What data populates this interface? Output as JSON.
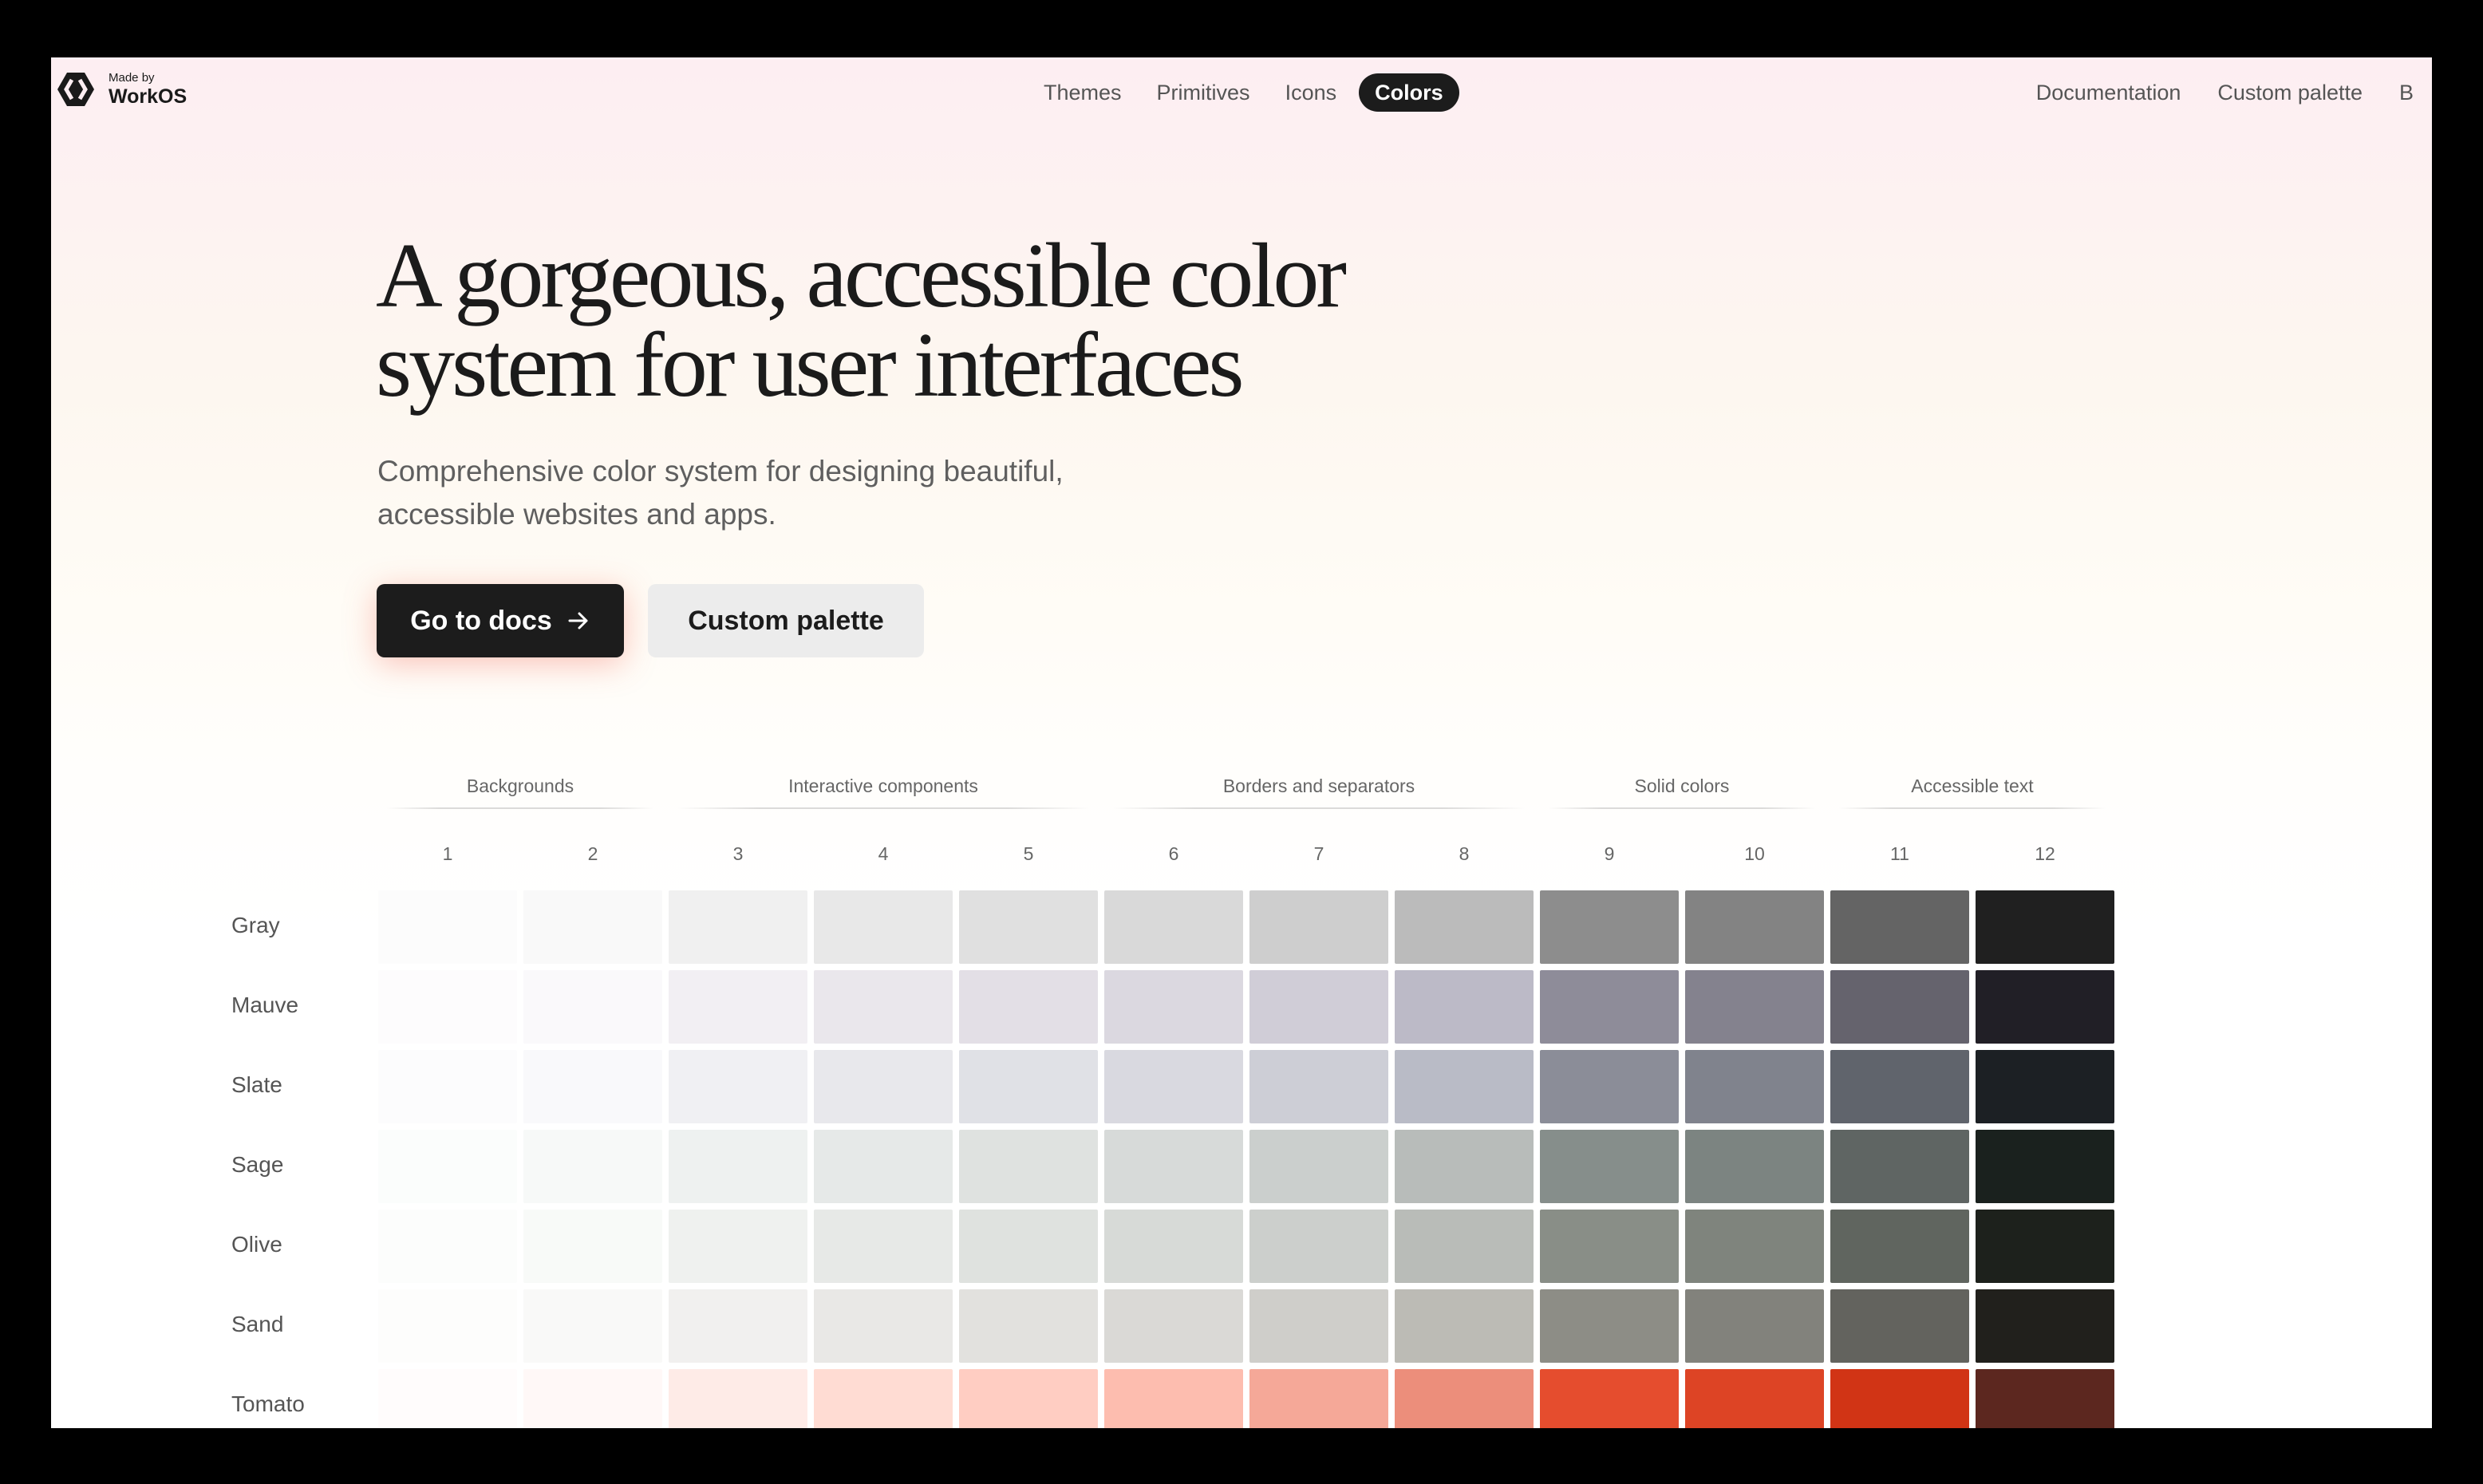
{
  "logo": {
    "small": "Made by",
    "brand": "WorkOS"
  },
  "nav": {
    "center": [
      "Themes",
      "Primitives",
      "Icons",
      "Colors"
    ],
    "active": "Colors",
    "right": [
      "Documentation",
      "Custom palette",
      "B"
    ]
  },
  "hero": {
    "title": "A gorgeous, accessible color system for user interfaces",
    "subtitle": "Comprehensive color system for designing beautiful, accessible websites and apps.",
    "primary_button": "Go to docs",
    "secondary_button": "Custom palette"
  },
  "palette": {
    "groups": [
      {
        "label": "Backgrounds",
        "from": 1,
        "to": 2
      },
      {
        "label": "Interactive components",
        "from": 3,
        "to": 5
      },
      {
        "label": "Borders and separators",
        "from": 6,
        "to": 8
      },
      {
        "label": "Solid colors",
        "from": 9,
        "to": 10
      },
      {
        "label": "Accessible text",
        "from": 11,
        "to": 12
      }
    ],
    "steps": [
      "1",
      "2",
      "3",
      "4",
      "5",
      "6",
      "7",
      "8",
      "9",
      "10",
      "11",
      "12"
    ],
    "rows": [
      {
        "name": "Gray",
        "colors": [
          "#fcfcfc",
          "#f9f9f9",
          "#f0f0f0",
          "#e8e8e8",
          "#e0e0e0",
          "#d9d9d9",
          "#cecece",
          "#bbbbbb",
          "#8d8d8d",
          "#838383",
          "#646464",
          "#202020"
        ]
      },
      {
        "name": "Mauve",
        "colors": [
          "#fdfcfd",
          "#faf9fb",
          "#f2eff3",
          "#eae7ec",
          "#e3dfe6",
          "#dbd8e0",
          "#d0cdd7",
          "#bcbac7",
          "#8e8c99",
          "#84828e",
          "#65636d",
          "#211f26"
        ]
      },
      {
        "name": "Slate",
        "colors": [
          "#fcfcfd",
          "#f9f9fb",
          "#f0f0f3",
          "#e8e8ec",
          "#e0e1e6",
          "#d9d9e0",
          "#cdced6",
          "#b9bbc6",
          "#8b8d98",
          "#80838d",
          "#60646c",
          "#1c2024"
        ]
      },
      {
        "name": "Sage",
        "colors": [
          "#fbfdfc",
          "#f7f9f8",
          "#eef1f0",
          "#e6e9e8",
          "#dfe2e0",
          "#d7dad9",
          "#cbcfcd",
          "#b8bcba",
          "#868e8b",
          "#7c8481",
          "#5f6563",
          "#1a211e"
        ]
      },
      {
        "name": "Olive",
        "colors": [
          "#fcfdfc",
          "#f8faf8",
          "#eff1ef",
          "#e7e9e7",
          "#dfe2df",
          "#d7dad7",
          "#cccfcc",
          "#b9bcb8",
          "#898e87",
          "#7f847d",
          "#60655f",
          "#1d211c"
        ]
      },
      {
        "name": "Sand",
        "colors": [
          "#fdfdfc",
          "#f9f9f8",
          "#f1f0ef",
          "#e9e8e6",
          "#e2e1de",
          "#dad9d6",
          "#cfceca",
          "#bcbbb5",
          "#8d8d86",
          "#82827c",
          "#63635e",
          "#21201c"
        ]
      },
      {
        "name": "Tomato",
        "colors": [
          "#fffcfc",
          "#fff8f7",
          "#feebe7",
          "#ffdcd3",
          "#ffcdc2",
          "#fdbdaf",
          "#f5a898",
          "#ec8e7b",
          "#e54d2e",
          "#dd4425",
          "#d13415",
          "#5c271f"
        ]
      }
    ]
  },
  "colors": {
    "accent_dark": "#1c1c1c",
    "muted_text": "#5f5f5f"
  },
  "icons": {
    "logo": "workos-logo-icon",
    "arrow": "arrow-right-icon"
  }
}
